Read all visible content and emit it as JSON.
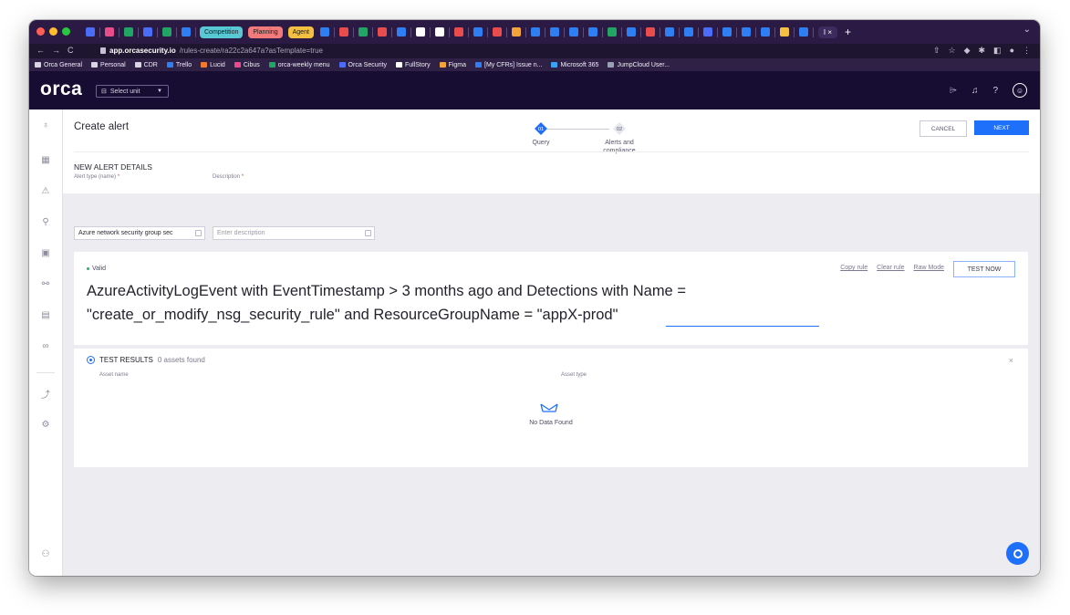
{
  "browser": {
    "tab_pills": [
      {
        "label": "Competition",
        "color": "#58c8d4"
      },
      {
        "label": "Planning",
        "color": "#f27a7a"
      },
      {
        "label": "Agent",
        "color": "#f5c040"
      }
    ],
    "active_tab_label": "I ×",
    "new_tab_label": "+",
    "url_host": "app.orcasecurity.io",
    "url_path": "/rules-create/ra22c2a647a?asTemplate=true",
    "bookmarks": [
      {
        "label": "Orca General",
        "icon": "folder-icon",
        "color": "#d9d4e6"
      },
      {
        "label": "Personal",
        "icon": "folder-icon",
        "color": "#d9d4e6"
      },
      {
        "label": "CDR",
        "icon": "folder-icon",
        "color": "#d9d4e6"
      },
      {
        "label": "Trello",
        "icon": "trello-icon",
        "color": "#2f7ff3"
      },
      {
        "label": "Lucid",
        "icon": "lucid-icon",
        "color": "#f27a2a"
      },
      {
        "label": "Cibus",
        "icon": "cibus-icon",
        "color": "#e84c8a"
      },
      {
        "label": "orca-weekly menu",
        "icon": "sheets-icon",
        "color": "#21a464"
      },
      {
        "label": "Orca Security",
        "icon": "orca-icon",
        "color": "#4a6cf7"
      },
      {
        "label": "FullStory",
        "icon": "fullstory-icon",
        "color": "#ffffff"
      },
      {
        "label": "Figma",
        "icon": "figma-icon",
        "color": "#f2a33a"
      },
      {
        "label": "[My CFRs] Issue n...",
        "icon": "jira-icon",
        "color": "#2f7ff3"
      },
      {
        "label": "Microsoft 365",
        "icon": "microsoft-icon",
        "color": "#3aa2f3"
      },
      {
        "label": "JumpCloud User...",
        "icon": "jumpcloud-icon",
        "color": "#9aa0b5"
      }
    ]
  },
  "app": {
    "logo": "orca",
    "select_unit_label": "Select unit",
    "page_title": "Create alert",
    "steps": [
      {
        "number": "01",
        "label": "Query",
        "active": true
      },
      {
        "number": "02",
        "label": "Alerts and compliance",
        "active": false
      }
    ],
    "cancel_label": "CANCEL",
    "next_label": "NEXT",
    "section_title": "NEW ALERT DETAILS",
    "alert_type_label": "Alert type (name)",
    "alert_type_value": "Azure network security group sec",
    "description_label": "Description",
    "description_placeholder": "Enter description",
    "required_marker": "*",
    "query": {
      "status": "Valid",
      "copy_rule": "Copy rule",
      "clear_rule": "Clear rule",
      "raw_mode": "Raw Mode",
      "test_now": "TEST NOW",
      "line1": "AzureActivityLogEvent with EventTimestamp > 3 months ago and Detections with Name =",
      "line2": "\"create_or_modify_nsg_security_rule\" and ResourceGroupName = \"appX-prod\""
    },
    "results": {
      "title": "TEST RESULTS",
      "count": "0 assets found",
      "col_asset_name": "Asset name",
      "col_asset_type": "Asset type",
      "empty_text": "No Data Found"
    }
  },
  "colors": {
    "brand_dark": "#170d33",
    "accent_blue": "#1e6ffa",
    "valid_green": "#21b46b"
  }
}
